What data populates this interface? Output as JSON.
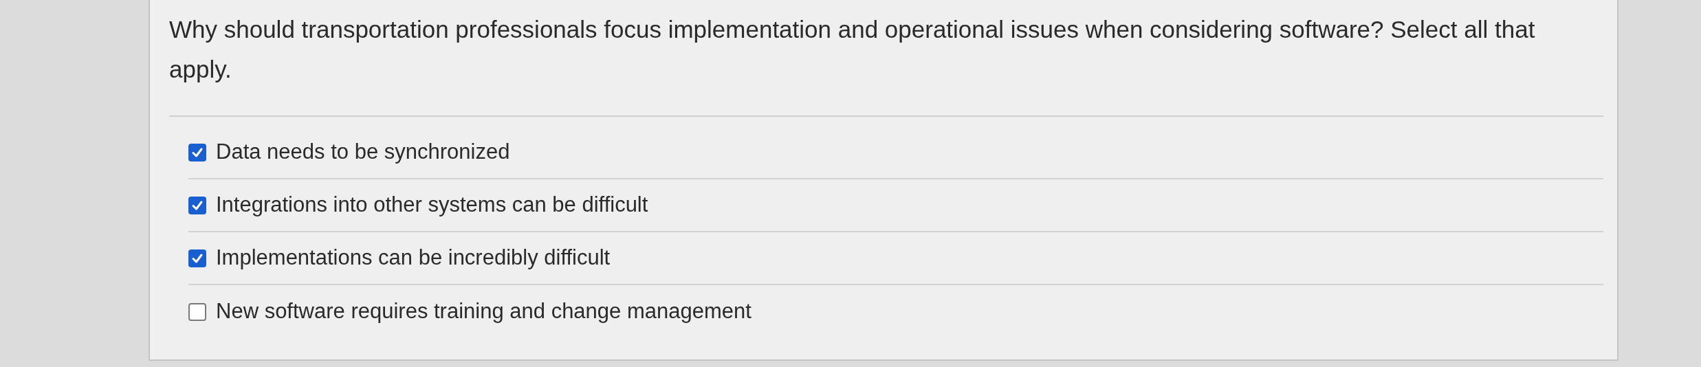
{
  "question": {
    "prompt": "Why should transportation professionals focus implementation and operational issues when considering software? Select all that apply.",
    "options": [
      {
        "label": "Data needs to be synchronized",
        "checked": true
      },
      {
        "label": "Integrations into other systems can be difficult",
        "checked": true
      },
      {
        "label": "Implementations can be incredibly difficult",
        "checked": true
      },
      {
        "label": "New software requires training and change management",
        "checked": false
      }
    ]
  }
}
